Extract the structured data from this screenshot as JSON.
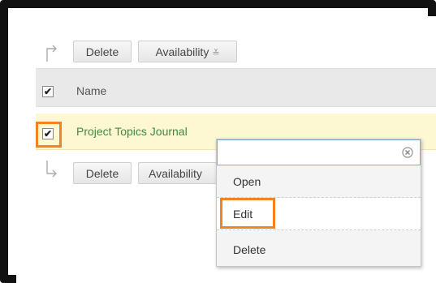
{
  "toolbar_top": {
    "delete_label": "Delete",
    "availability_label": "Availability",
    "availability_chevron": "≚"
  },
  "toolbar_bottom": {
    "delete_label": "Delete",
    "availability_label": "Availability"
  },
  "table": {
    "header": {
      "name_label": "Name",
      "checked": "✔"
    },
    "rows": [
      {
        "title": "Project Topics Journal",
        "checked": "✔"
      }
    ]
  },
  "context_menu": {
    "items": [
      {
        "label": "Open"
      },
      {
        "label": "Edit"
      },
      {
        "label": "Delete"
      }
    ]
  },
  "colors": {
    "highlight_orange": "#f58220",
    "link_green": "#3f8b3f",
    "row_highlight": "#fdf7d2"
  }
}
